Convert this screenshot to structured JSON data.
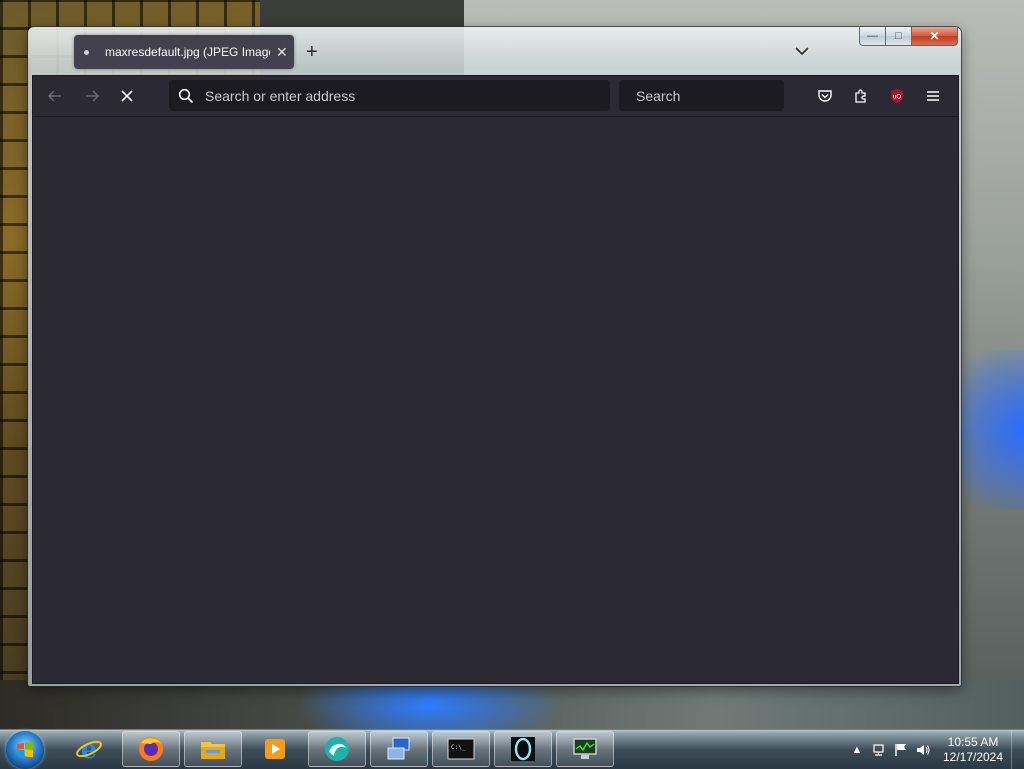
{
  "window": {
    "caption_buttons": {
      "minimize": "—",
      "maximize": "□",
      "close": "✕"
    }
  },
  "tabs": [
    {
      "title": "maxresdefault.jpg (JPEG Image"
    }
  ],
  "toolbar": {
    "url_placeholder": "Search or enter address",
    "search_placeholder": "Search"
  },
  "taskbar": {
    "apps": [
      {
        "icon": "internet-explorer-icon"
      },
      {
        "icon": "firefox-icon"
      },
      {
        "icon": "file-explorer-icon"
      },
      {
        "icon": "media-player-icon"
      },
      {
        "icon": "app-swirl-icon"
      },
      {
        "icon": "remote-desktop-icon"
      },
      {
        "icon": "command-prompt-icon"
      },
      {
        "icon": "ring-app-icon"
      },
      {
        "icon": "task-manager-icon"
      }
    ]
  },
  "clock": {
    "time": "10:55 AM",
    "date": "12/17/2024"
  },
  "colors": {
    "ublock": "#a1182f",
    "content_bg": "#2b2a33",
    "urlbar_bg": "#1c1b22"
  }
}
